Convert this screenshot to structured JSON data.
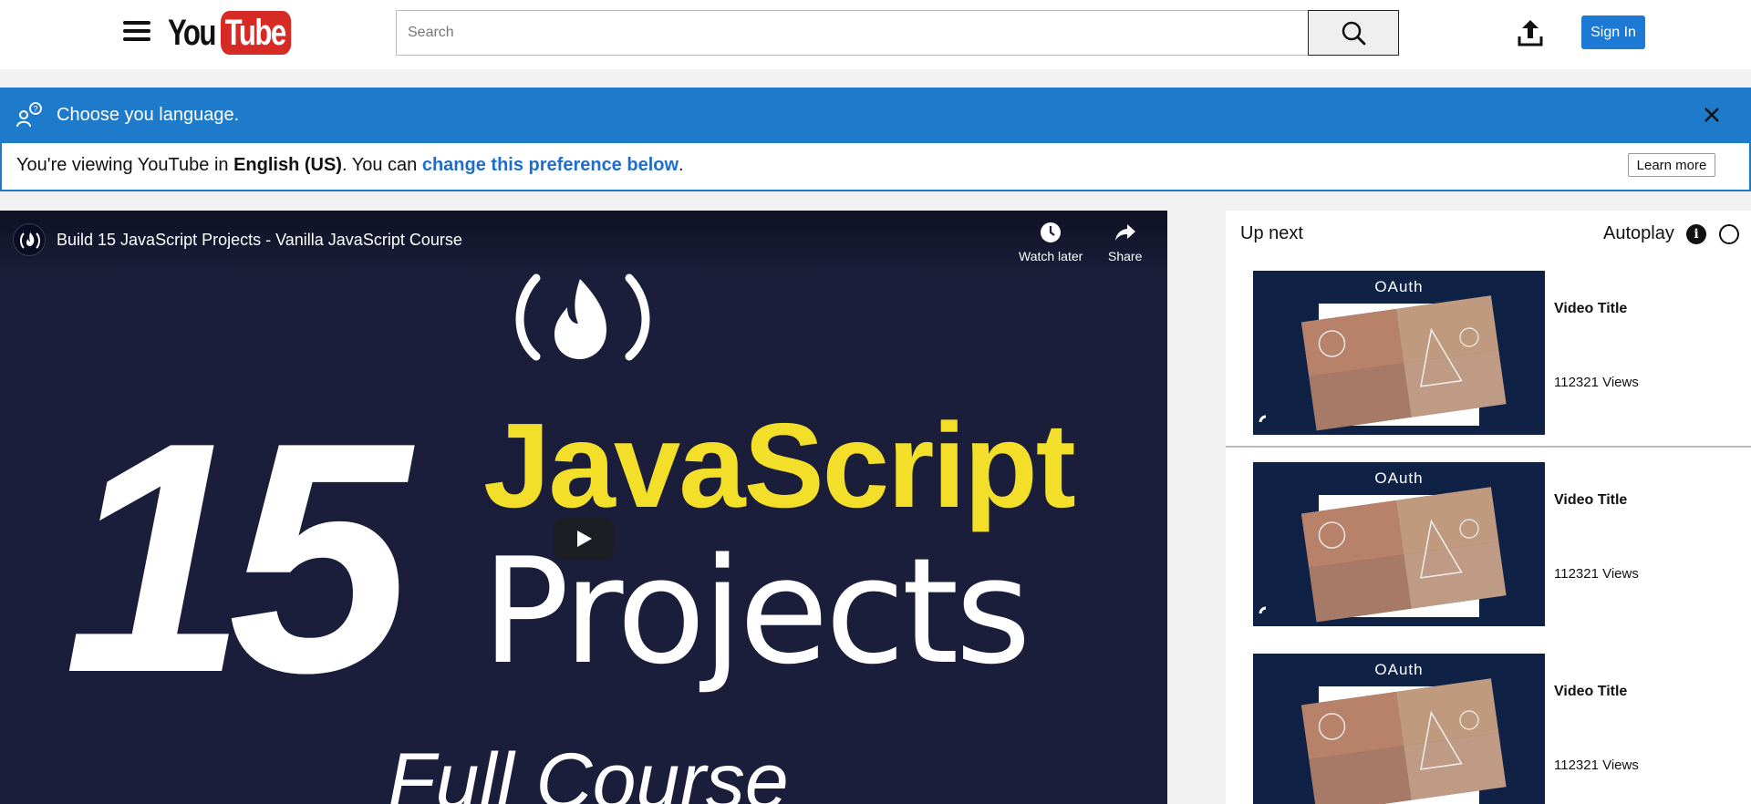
{
  "header": {
    "logo_you": "You",
    "logo_tube": "Tube",
    "search_placeholder": "Search",
    "sign_in_label": "Sign In"
  },
  "language_banner": {
    "title": "Choose you language.",
    "text_prefix": "You're viewing YouTube in ",
    "language": "English (US)",
    "text_middle": ". You can ",
    "link_text": "change this preference below",
    "text_suffix": ".",
    "learn_more_label": "Learn more"
  },
  "player": {
    "title": "Build 15 JavaScript Projects - Vanilla JavaScript Course",
    "watch_later_label": "Watch later",
    "share_label": "Share",
    "thumbnail": {
      "number": "15",
      "line1": "JavaScript",
      "line2": "Projects",
      "line3": "Full Course"
    }
  },
  "sidebar": {
    "up_next_label": "Up next",
    "autoplay_label": "Autoplay",
    "info_glyph": "i",
    "items": [
      {
        "title": "Video Title",
        "views": "112321 Views",
        "thumb_text": "OAuth"
      },
      {
        "title": "Video Title",
        "views": "112321 Views",
        "thumb_text": "OAuth"
      },
      {
        "title": "Video Title",
        "views": "112321 Views",
        "thumb_text": "OAuth"
      }
    ]
  },
  "colors": {
    "brand_red": "#d62a24",
    "banner_blue": "#1e7bcb",
    "js_yellow": "#f3df2a",
    "player_bg": "#1a1e3a"
  }
}
